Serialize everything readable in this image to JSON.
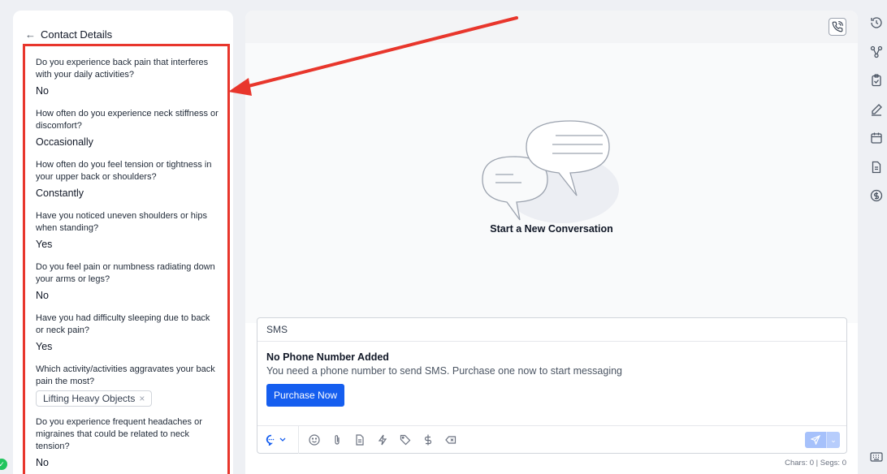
{
  "contact_panel": {
    "title": "Contact Details",
    "questions": [
      {
        "question": "Do you experience back pain that interferes with your daily activities?",
        "answer": "No"
      },
      {
        "question": "How often do you experience neck stiffness or discomfort?",
        "answer": "Occasionally"
      },
      {
        "question": "How often do you feel tension or tightness in your upper back or shoulders?",
        "answer": "Constantly"
      },
      {
        "question": "Have you noticed uneven shoulders or hips when standing?",
        "answer": "Yes"
      },
      {
        "question": "Do you feel pain or numbness radiating down your arms or legs?",
        "answer": "No"
      },
      {
        "question": "Have you had difficulty sleeping due to back or neck pain?",
        "answer": "Yes"
      },
      {
        "question": "Which activity/activities aggravates your back pain the most?",
        "chip": "Lifting Heavy Objects"
      },
      {
        "question": "Do you experience frequent headaches or migraines that could be related to neck tension?",
        "answer": "No"
      }
    ]
  },
  "conversation": {
    "empty_title": "Start a New Conversation"
  },
  "composer": {
    "channel_tab": "SMS",
    "notice_title": "No Phone Number Added",
    "notice_text": "You need a phone number to send SMS. Purchase one now to start messaging",
    "purchase_button": "Purchase Now",
    "char_count": "Chars: 0 | Segs: 0"
  },
  "icons": {
    "rail": [
      "history-icon",
      "workflow-icon",
      "clipboard-icon",
      "pen-icon",
      "calendar-icon",
      "document-icon",
      "dollar-icon"
    ],
    "toolbar": [
      "chat-icon",
      "emoji-icon",
      "attachment-icon",
      "template-icon",
      "lightning-icon",
      "tag-icon",
      "dollar-icon",
      "clear-icon"
    ]
  },
  "colors": {
    "accent": "#155eef",
    "highlight": "#e8362c",
    "status": "#22c55e"
  }
}
